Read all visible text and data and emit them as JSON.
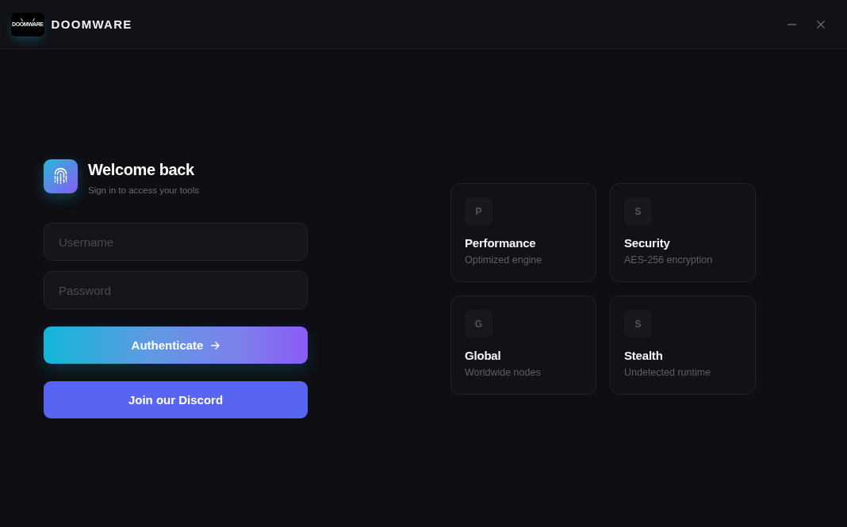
{
  "window": {
    "logo_text": "DOOMWARE",
    "brand": "DOOMWARE"
  },
  "login": {
    "title": "Welcome back",
    "subtitle": "Sign in to access your tools",
    "fields": [
      {
        "placeholder": "Username"
      },
      {
        "placeholder": "Password"
      }
    ],
    "buttons": [
      {
        "kind": "primary",
        "label": "Authenticate"
      },
      {
        "kind": "discord",
        "label": "Join our Discord"
      }
    ]
  },
  "features": [
    {
      "initial": "P",
      "title": "Performance",
      "description": "Optimized engine"
    },
    {
      "initial": "S",
      "title": "Security",
      "description": "AES-256 encryption"
    },
    {
      "initial": "G",
      "title": "Global",
      "description": "Worldwide nodes"
    },
    {
      "initial": "S",
      "title": "Stealth",
      "description": "Undetected runtime"
    }
  ]
}
